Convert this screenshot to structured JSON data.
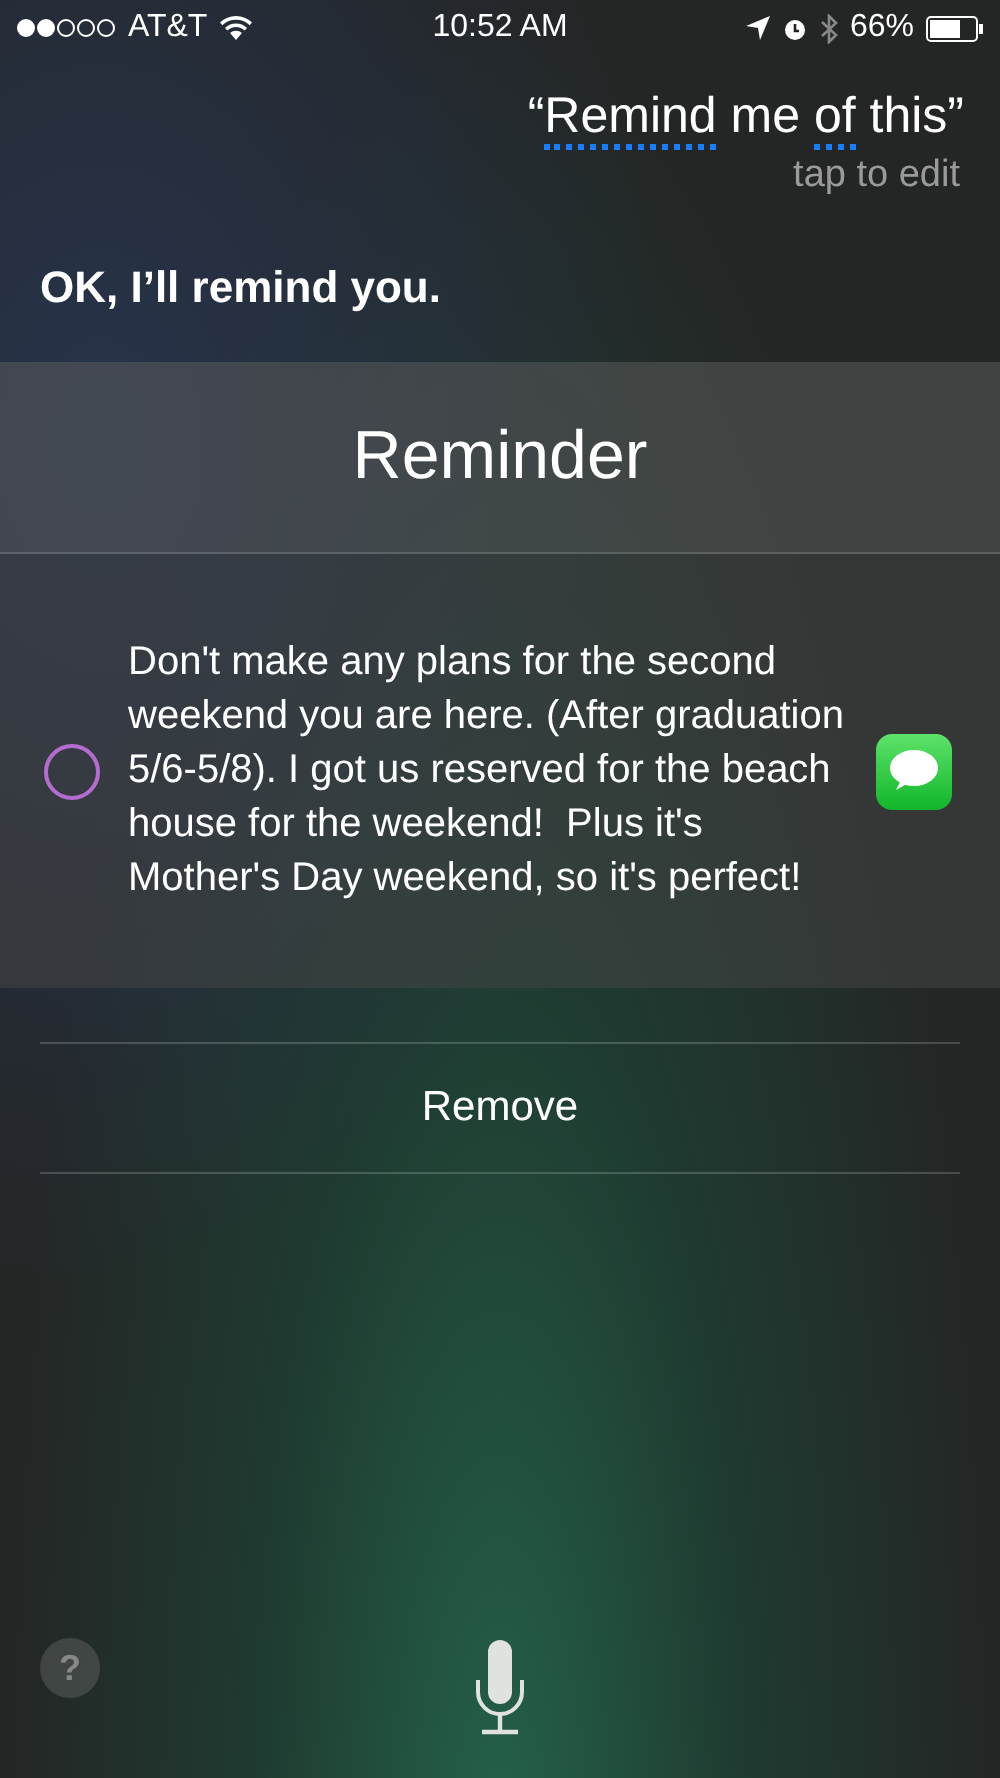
{
  "status_bar": {
    "carrier": "AT&T",
    "time": "10:52 AM",
    "battery": "66%"
  },
  "query": {
    "parts": [
      {
        "text": "“",
        "flagged": false
      },
      {
        "text": "Remind",
        "flagged": true
      },
      {
        "text": " me ",
        "flagged": false
      },
      {
        "text": "of",
        "flagged": true
      },
      {
        "text": " this”",
        "flagged": false
      }
    ],
    "hint": "tap to edit"
  },
  "response": "OK, I’ll remind you.",
  "reminder": {
    "title": "Reminder",
    "checked": false,
    "text": "Don't make any plans for the second weekend you are here. (After graduation 5/6-5/8). I got us reserved for the beach house for the weekend!  Plus it's Mother's Day weekend, so it's perfect!"
  },
  "remove_button": "Remove",
  "help_button": "?"
}
